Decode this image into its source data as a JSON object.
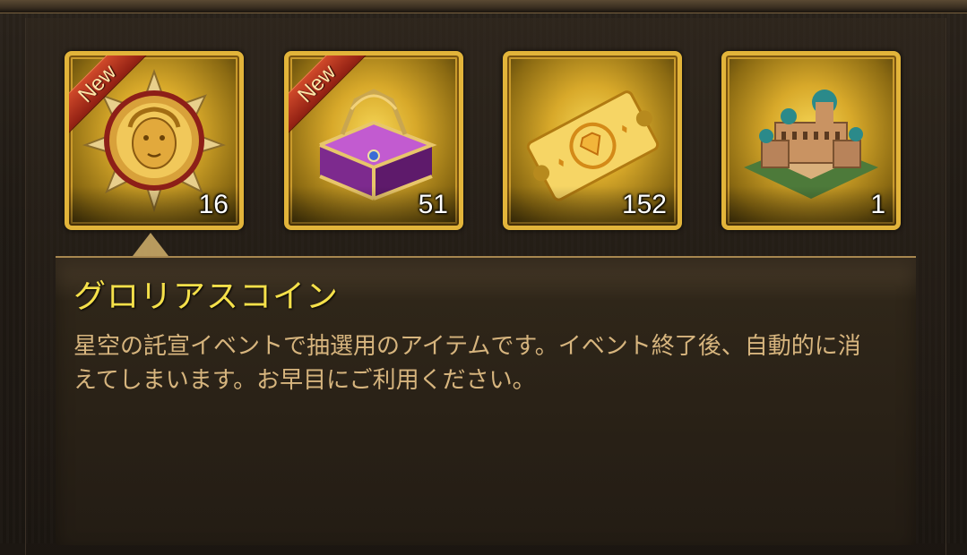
{
  "items": [
    {
      "name": "gloria-coin",
      "icon": "sun-medallion-icon",
      "count": "16",
      "badge": "New"
    },
    {
      "name": "treasure-chest",
      "icon": "purple-treasure-chest-icon",
      "count": "51",
      "badge": "New"
    },
    {
      "name": "diamond-ticket",
      "icon": "gold-diamond-ticket-icon",
      "count": "152",
      "badge": ""
    },
    {
      "name": "palace",
      "icon": "palace-building-icon",
      "count": "1",
      "badge": ""
    }
  ],
  "selected": {
    "title": "グロリアスコイン",
    "description": "星空の託宣イベントで抽選用のアイテムです。イベント終了後、自動的に消えてしまいます。お早目にご利用ください。"
  },
  "colors": {
    "title": "#f5e04a",
    "description": "#d7b57e",
    "frame_gold": "#e2b43a",
    "ribbon_red": "#b53520"
  }
}
